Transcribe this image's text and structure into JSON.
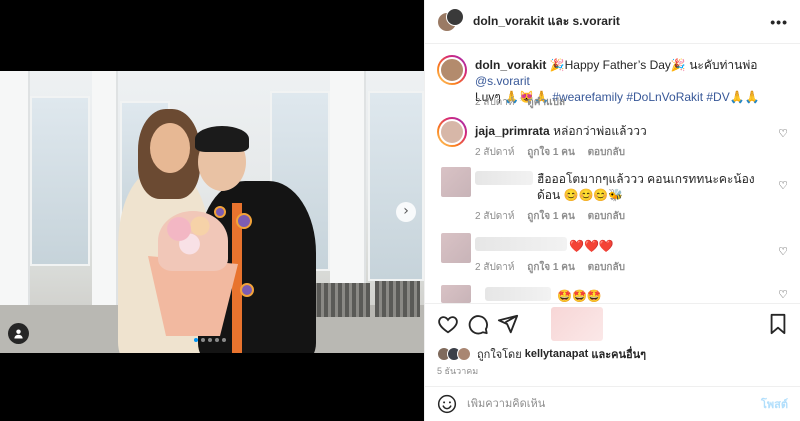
{
  "header": {
    "title": "doln_vorakit และ s.vorarit",
    "more_label": "•••"
  },
  "caption": {
    "username": "doln_vorakit",
    "text_1": "🎉Happy Father’s Day🎉 นะคับท่านพ่อ",
    "mention": "@s.vorarit",
    "text_2": "Luvๆ 🙏😻🙏",
    "hashtags": "#wearefamily #DoLnVoRakit #DV🙏🙏",
    "time": "2 สัปดาห์",
    "translate_label": "ดูคำแปล"
  },
  "comments": [
    {
      "username": "jaja_primrata",
      "text": "หล่อกว่าพ่อแล้ววว",
      "time": "2 สัปดาห์",
      "likes": "ถูกใจ 1 คน",
      "reply": "ตอบกลับ"
    },
    {
      "username": "",
      "text": "ฮือออโตมากๆแล้ววว คอนเกรททนะคะน้องด้อน 😊😊😊🐝",
      "time": "2 สัปดาห์",
      "likes": "ถูกใจ 1 คน",
      "reply": "ตอบกลับ"
    },
    {
      "username": "",
      "text": "❤️❤️❤️",
      "time": "2 สัปดาห์",
      "likes": "ถูกใจ 1 คน",
      "reply": "ตอบกลับ"
    },
    {
      "username": "",
      "text": "🤩🤩🤩"
    }
  ],
  "liked_by": {
    "prefix": "ถูกใจโดย",
    "user": "kellytanapat",
    "suffix": "และคนอื่นๆ"
  },
  "post_date": "5 ธันวาคม",
  "comment_box": {
    "placeholder": "เพิ่มความคิดเห็น",
    "post_label": "โพสต์"
  },
  "colors": {
    "link": "#385898",
    "accent": "#0095f6",
    "muted": "#8e8e8e",
    "heart_red": "#ed4956"
  },
  "icons": [
    "tag-people-icon",
    "next-arrow-icon",
    "heart-icon",
    "comment-icon",
    "share-icon",
    "save-icon",
    "emoji-icon",
    "more-icon"
  ]
}
